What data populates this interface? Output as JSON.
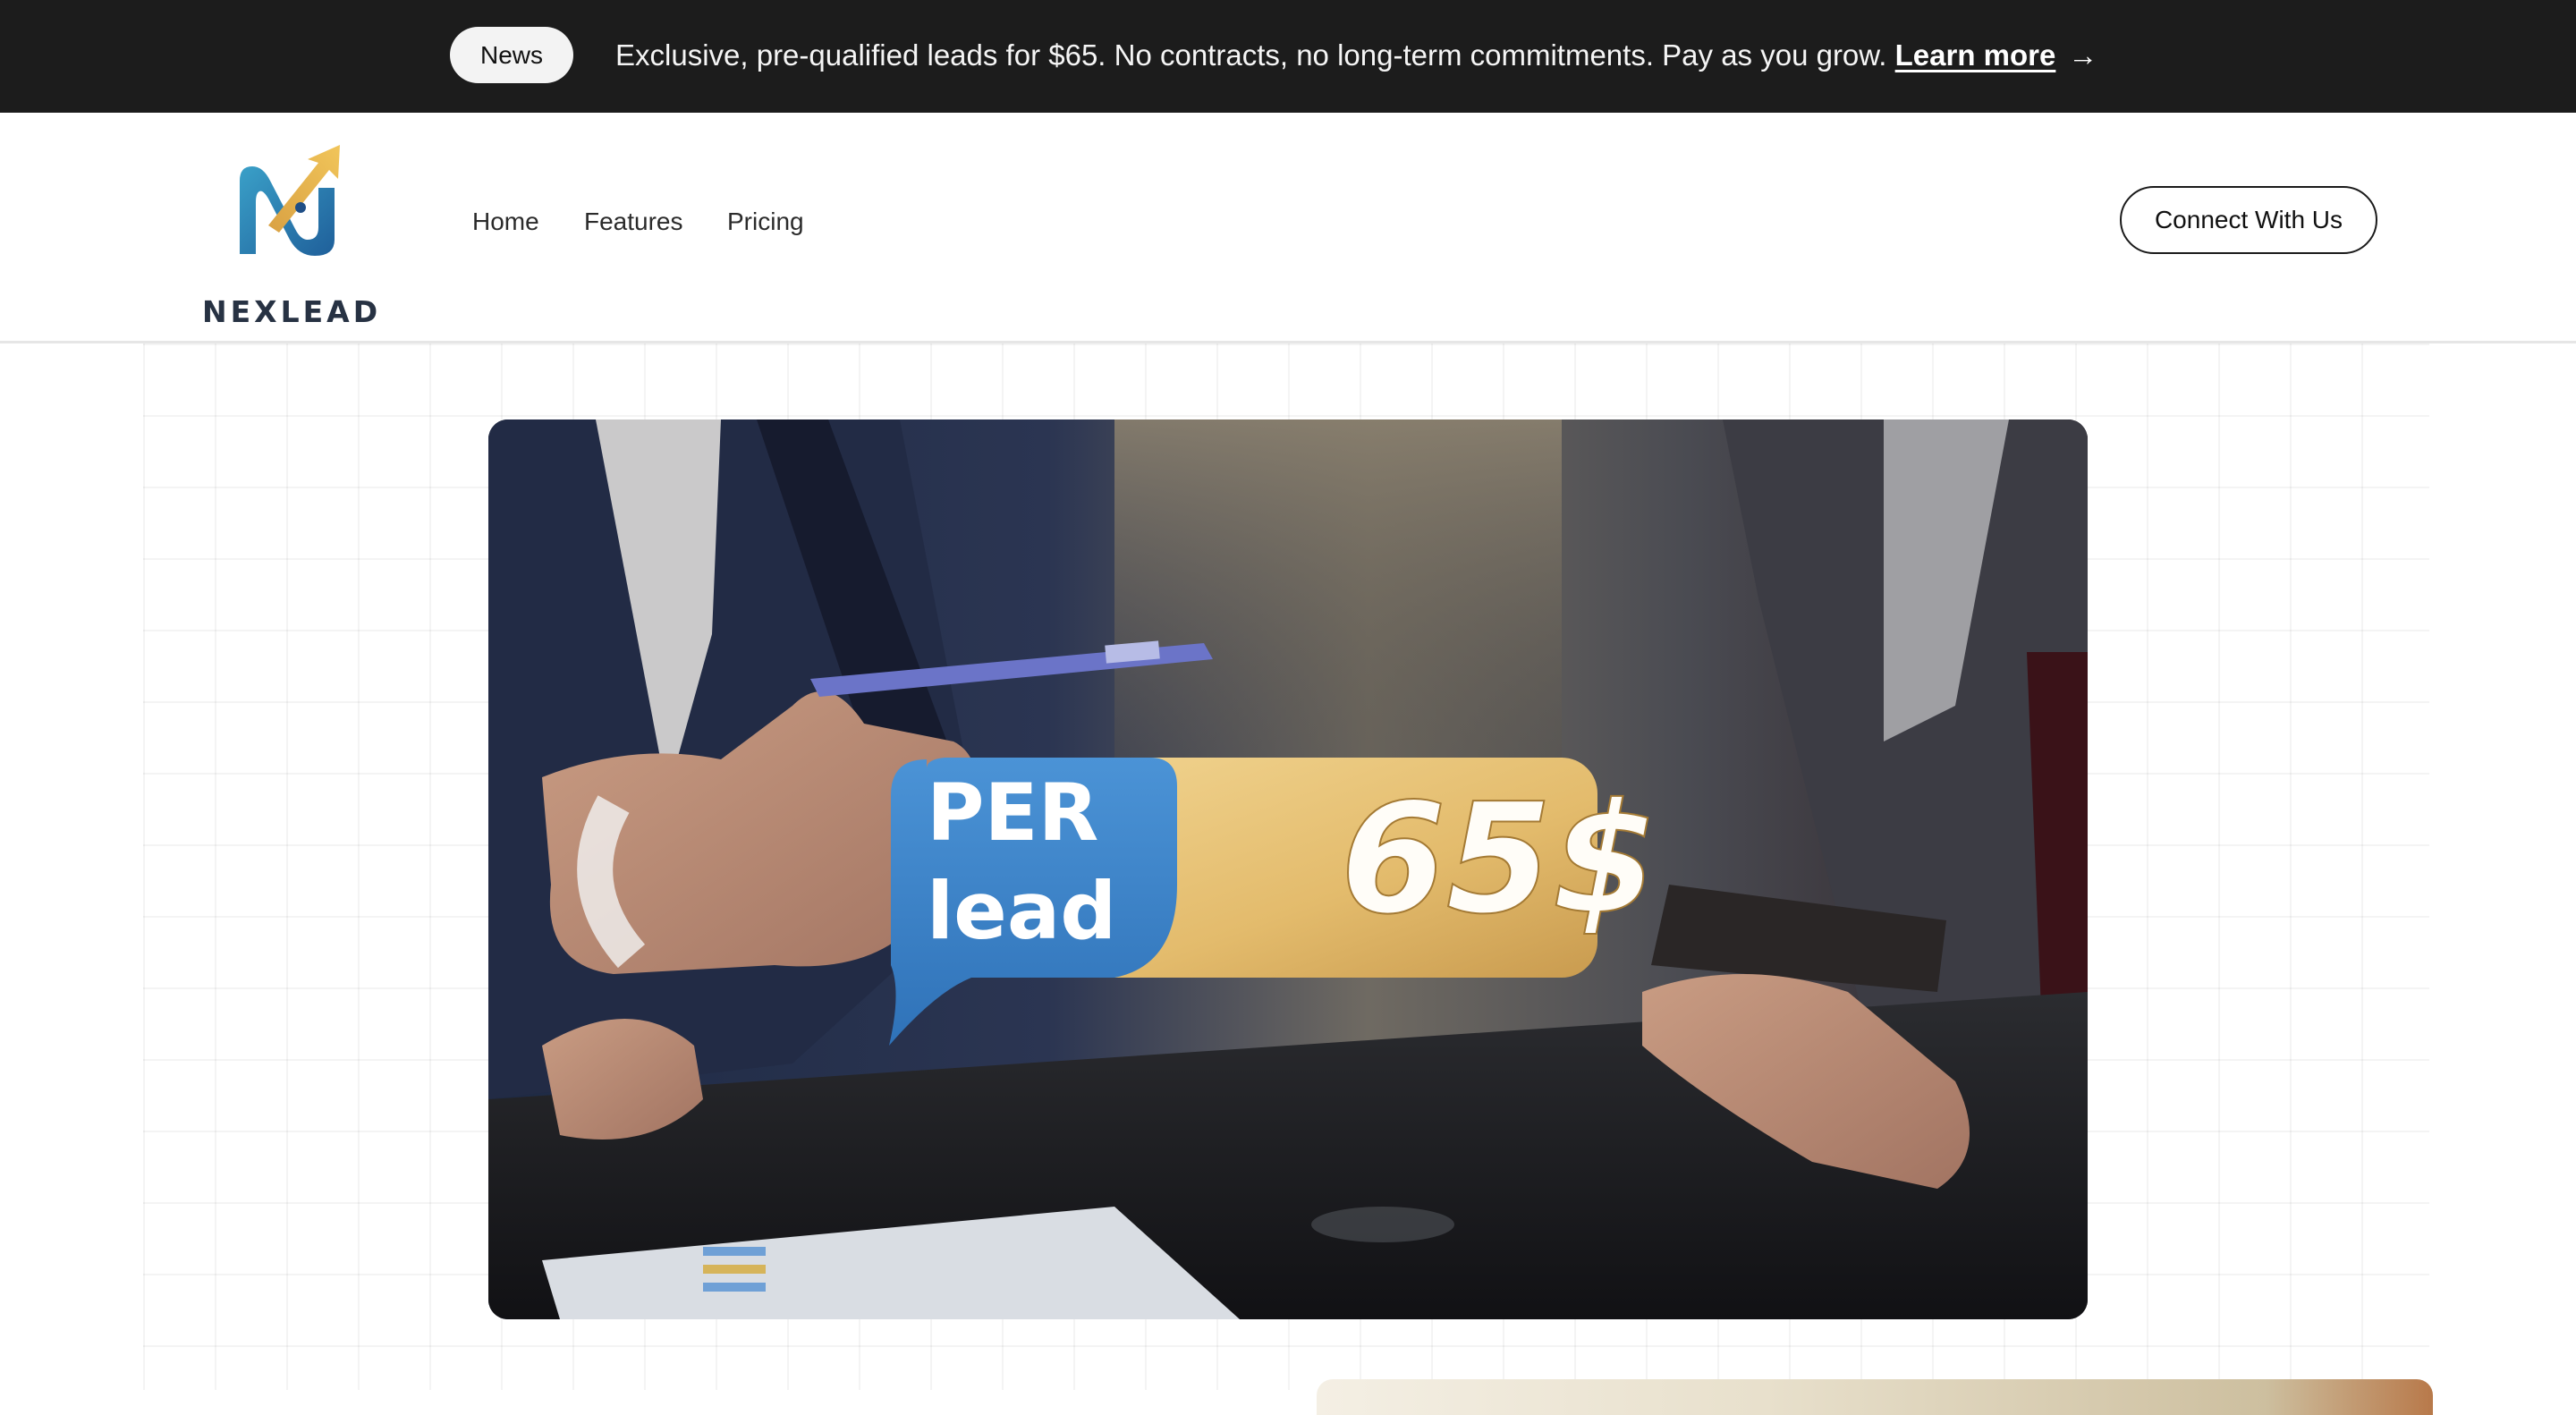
{
  "announcement": {
    "badge": "News",
    "text": "Exclusive, pre-qualified leads for $65. No contracts, no long-term commitments. Pay as you grow.",
    "link_label": "Learn more",
    "arrow": "→"
  },
  "header": {
    "logo_text": "NEXLEAD",
    "nav": [
      {
        "label": "Home"
      },
      {
        "label": "Features"
      },
      {
        "label": "Pricing"
      }
    ],
    "cta_label": "Connect With Us"
  },
  "hero": {
    "badge_left_line1": "PER",
    "badge_left_line2": "lead",
    "badge_price": "65$"
  },
  "colors": {
    "announce_bg": "#1c1c1c",
    "badge_blue": "#3f86c9",
    "badge_gold": "#e4c073",
    "logo_navy": "#273243"
  }
}
